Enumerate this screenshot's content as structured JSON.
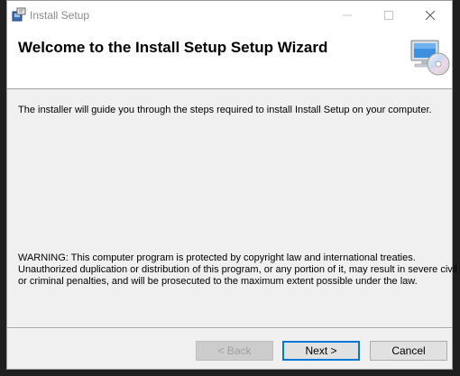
{
  "window": {
    "title": "Install Setup"
  },
  "header": {
    "title": "Welcome to the Install Setup Setup Wizard"
  },
  "body": {
    "intro": "The installer will guide you through the steps required to install Install Setup on your computer.",
    "warning_lines": [
      "WARNING: This computer program is protected by copyright law and international treaties.",
      "Unauthorized duplication or distribution of this program, or any portion of it, may result in severe civil",
      "or criminal penalties, and will be prosecuted to the maximum extent possible under the law."
    ]
  },
  "buttons": {
    "back": "< Back",
    "next": "Next >",
    "cancel": "Cancel"
  },
  "icons": {
    "app": "installer-icon",
    "header": "computer-cd-icon",
    "minimize": "minimize-icon",
    "maximize": "maximize-icon",
    "close": "close-icon"
  },
  "colors": {
    "accent": "#0078d7",
    "dialog_bg": "#f0f0f0",
    "header_bg": "#ffffff"
  }
}
